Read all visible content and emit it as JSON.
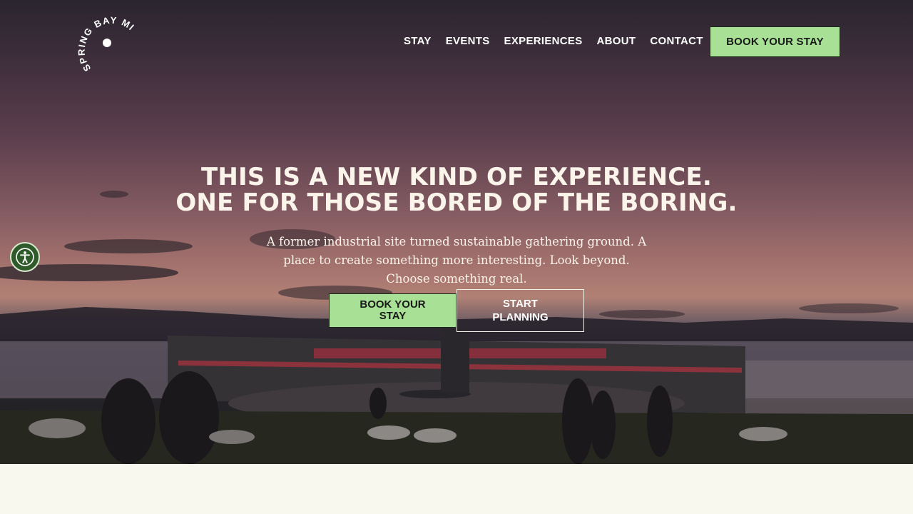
{
  "brand": {
    "logo_text": "SPRING BAY MILL"
  },
  "nav": {
    "items": [
      "STAY",
      "EVENTS",
      "EXPERIENCES",
      "ABOUT",
      "CONTACT"
    ],
    "cta_label": "BOOK YOUR STAY"
  },
  "hero": {
    "headline_line1": "THIS IS A NEW KIND OF EXPERIENCE.",
    "headline_line2": "ONE FOR THOSE BORED OF THE BORING.",
    "subtext": "A former industrial site turned sustainable gathering ground. A place to create something more interesting. Look beyond. Choose something real.",
    "primary_cta": "BOOK YOUR STAY",
    "secondary_cta": "START PLANNING"
  },
  "accessibility": {
    "icon": "accessibility-icon"
  },
  "colors": {
    "accent": "#a8e096",
    "text_light": "#fbf4ea",
    "accessibility_bg": "#2f5a2a",
    "page_bg": "#f8f8ee"
  }
}
